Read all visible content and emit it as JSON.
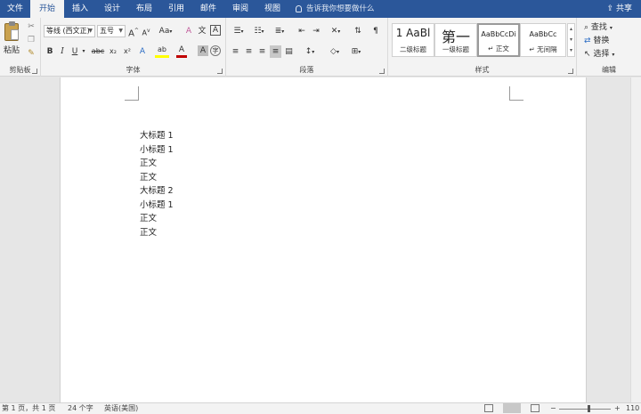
{
  "tabs": [
    {
      "label": "文件",
      "active": false
    },
    {
      "label": "开始",
      "active": true
    },
    {
      "label": "插入",
      "active": false
    },
    {
      "label": "设计",
      "active": false
    },
    {
      "label": "布局",
      "active": false
    },
    {
      "label": "引用",
      "active": false
    },
    {
      "label": "邮件",
      "active": false
    },
    {
      "label": "审阅",
      "active": false
    },
    {
      "label": "视图",
      "active": false
    }
  ],
  "tellme": "告诉我你想要做什么",
  "share": "共享",
  "clipboard": {
    "paste_label": "粘贴",
    "group_label": "剪贴板"
  },
  "font": {
    "name": "等线 (西文正)",
    "size": "五号",
    "grow": "A",
    "shrink": "A",
    "case": "Aa",
    "clear": "A",
    "wen": "文",
    "border_char": "A",
    "bold": "B",
    "italic": "I",
    "underline": "U",
    "strike": "abc",
    "sub": "x₂",
    "sup": "x²",
    "effect": "A",
    "highlight": "ab",
    "color": "A",
    "shade": "A",
    "circle": "字",
    "group_label": "字体"
  },
  "paragraph": {
    "group_label": "段落"
  },
  "styles": {
    "items": [
      {
        "sample": "1 AaBl",
        "name": "二级标题"
      },
      {
        "sample": "第一",
        "name": "一级标题"
      },
      {
        "sample": "AaBbCcDi",
        "name": "↵ 正文"
      },
      {
        "sample": "AaBbCc",
        "name": "↵ 无间隔"
      }
    ],
    "group_label": "样式"
  },
  "editing": {
    "find": "查找",
    "replace": "替换",
    "select": "选择",
    "group_label": "编辑"
  },
  "document": {
    "lines": [
      "大标题 1",
      "小标题 1",
      "正文",
      "正文",
      "大标题 2",
      "小标题 1",
      "正文",
      "正文"
    ]
  },
  "status": {
    "page": "第 1 页，共 1 页",
    "words": "24 个字",
    "language": "英语(美国)",
    "zoom": "110"
  },
  "colors": {
    "brand": "#2b579a",
    "font_color": "#c00000",
    "highlight": "#ffff00"
  }
}
